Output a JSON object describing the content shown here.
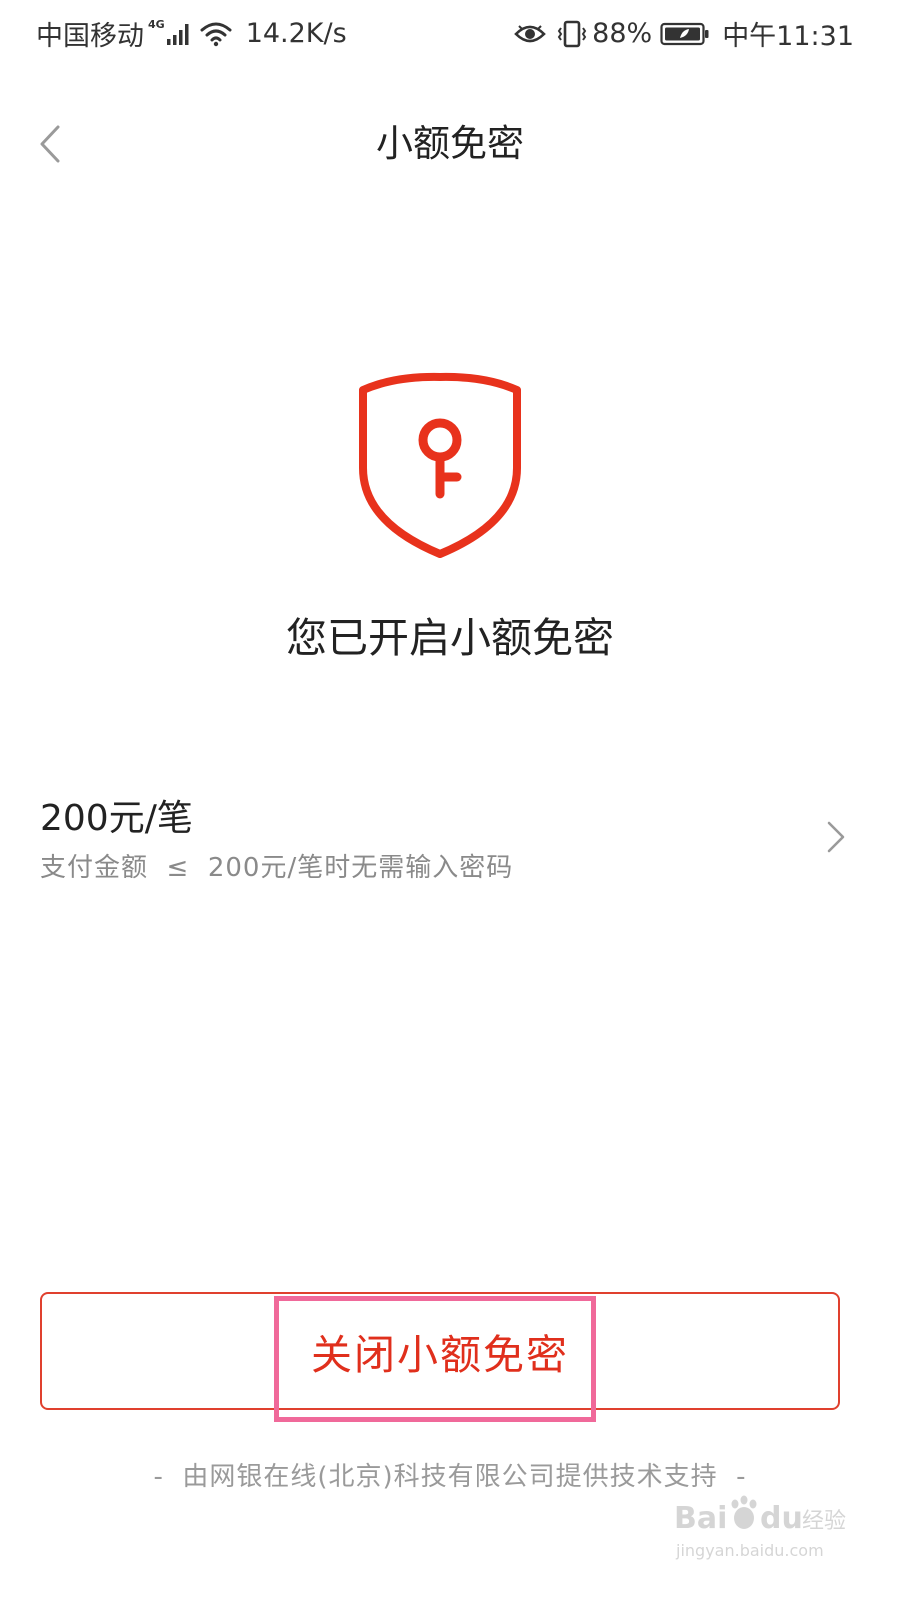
{
  "status_bar": {
    "carrier": "中国移动",
    "network_type": "4G",
    "speed": "14.2K/s",
    "battery": "88%",
    "time": "中午11:31"
  },
  "header": {
    "title": "小额免密"
  },
  "status": {
    "title": "您已开启小额免密"
  },
  "limit": {
    "amount": "200元/笔",
    "description": "支付金额  ≤  200元/笔时无需输入密码"
  },
  "action": {
    "close_label": "关闭小额免密"
  },
  "footer": {
    "note": "-  由网银在线(北京)科技有限公司提供技术支持  -"
  },
  "watermark": {
    "logo_text": "Baidu经验",
    "url": "jingyan.baidu.com"
  },
  "colors": {
    "accent": "#e02f1c",
    "highlight": "#f0699a",
    "text_primary": "#222222",
    "text_secondary": "#8a8a8a"
  }
}
